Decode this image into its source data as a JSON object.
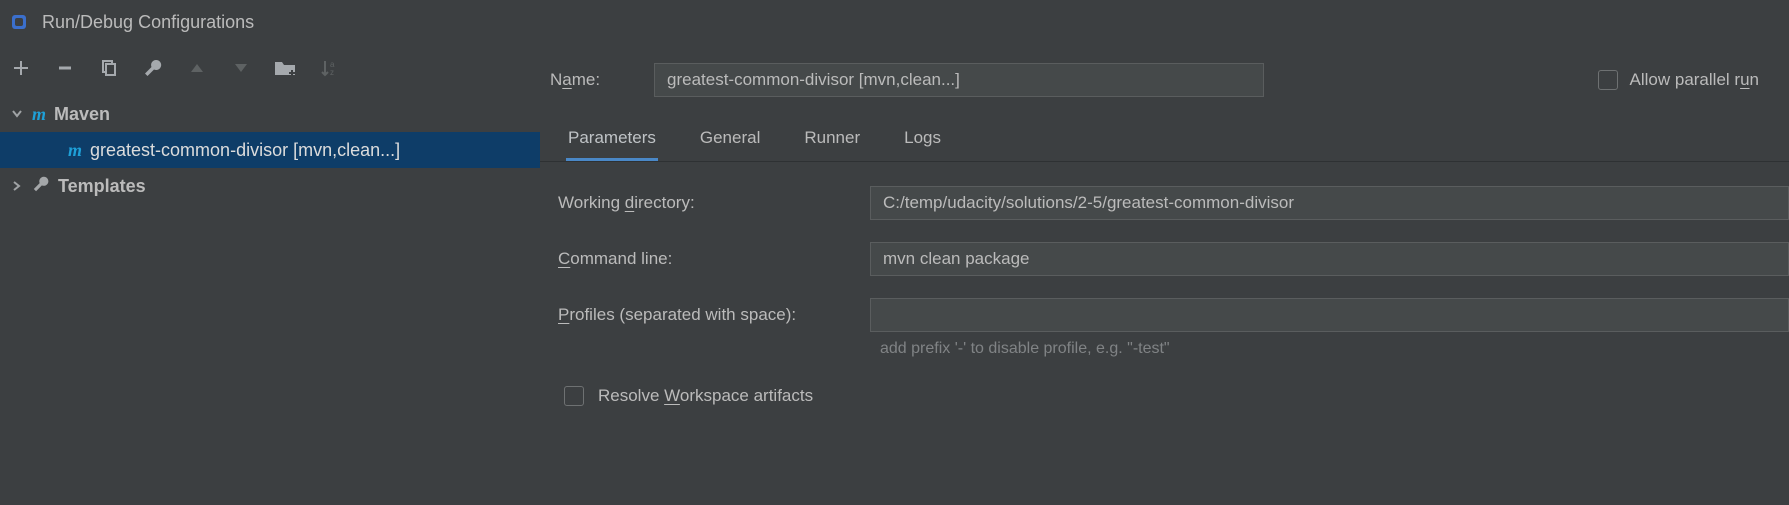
{
  "window": {
    "title": "Run/Debug Configurations"
  },
  "toolbar": {
    "add": "add-icon",
    "remove": "remove-icon",
    "copy": "copy-icon",
    "wrench": "wrench-icon",
    "up": "up-icon",
    "down": "down-icon",
    "folder": "folder-icon",
    "sort": "sort-az-icon"
  },
  "tree": {
    "maven": {
      "label": "Maven"
    },
    "config": {
      "label": "greatest-common-divisor [mvn,clean...]"
    },
    "templates": {
      "label": "Templates"
    }
  },
  "name": {
    "label_pre": "N",
    "label_u": "a",
    "label_post": "me:",
    "value": "greatest-common-divisor [mvn,clean...]"
  },
  "allow": {
    "pre": "Allow parallel r",
    "u": "u",
    "post": "n"
  },
  "tabs": {
    "parameters": "Parameters",
    "general": "General",
    "runner": "Runner",
    "logs": "Logs"
  },
  "fields": {
    "workdir": {
      "label_pre": "Working ",
      "label_u": "d",
      "label_post": "irectory:",
      "value": "C:/temp/udacity/solutions/2-5/greatest-common-divisor"
    },
    "cmd": {
      "label_u": "C",
      "label_post": "ommand line:",
      "value": "mvn clean package"
    },
    "profiles": {
      "label_u": "P",
      "label_post": "rofiles (separated with space):",
      "value": "",
      "hint": "add prefix '-' to disable profile, e.g. \"-test\""
    },
    "resolve": {
      "pre": "Resolve ",
      "u": "W",
      "post": "orkspace artifacts"
    }
  }
}
